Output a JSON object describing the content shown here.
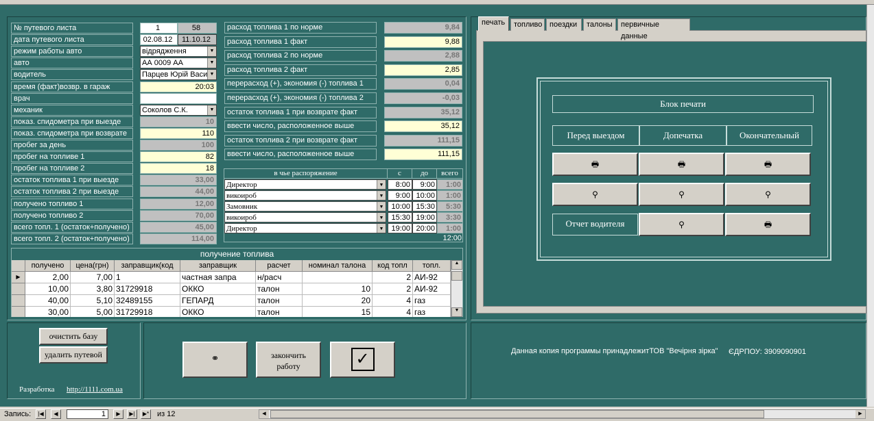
{
  "left_labels": [
    "№ путевого листа",
    "дата путевого листа",
    "режим работы авто",
    "авто",
    "водитель",
    "время (факт)возвр. в гараж",
    "врач",
    "механик",
    "показ. спидометра при выезде",
    "показ. спидометра при возврате",
    "пробег за день",
    "пробег на топливе 1",
    "пробег на топливе 2",
    "остаток  топлива 1 при выезде",
    "остаток топлива 2 при выезде",
    "получено топливо 1",
    "получено топливо 2",
    "всего топл. 1 (остаток+получено)",
    "всего топл. 2 (остаток+получено)"
  ],
  "left_values": {
    "waybill_no": "1",
    "waybill_no2": "58",
    "date": "02.08.12",
    "date2": "11.10.12",
    "mode": "відрядження",
    "auto": "АА 0009 АА",
    "driver": "Парцев Юрій Васи",
    "return_time": "20:03",
    "doctor": "",
    "mechanic": "Соколов С.К.",
    "odo_out": "10",
    "odo_in": "110",
    "mileage": "100",
    "mileage_f1": "82",
    "mileage_f2": "18",
    "rest1_out": "33,00",
    "rest2_out": "44,00",
    "recv1": "12,00",
    "recv2": "70,00",
    "total1": "45,00",
    "total2": "114,00"
  },
  "mid_labels": [
    "расход топлива 1 по норме",
    "расход топлива 1 факт",
    "расход топлива 2 по норме",
    "расход топлива 2 факт",
    "перерасход (+), экономия (-) топлива 1",
    "перерасход (+), экономия (-) топлива 2",
    "остаток топлива 1 при возврате факт",
    "ввести число, расположенное выше",
    "остаток топлива 2 при возврате факт",
    "ввести число, расположенное выше"
  ],
  "mid_values": [
    "9,84",
    "9,88",
    "2,88",
    "2,85",
    "0,04",
    "-0,03",
    "35,12",
    "35,12",
    "111,15",
    "111,15"
  ],
  "disposal": {
    "headers": [
      "в чье распоряжение",
      "с",
      "до",
      "всего"
    ],
    "rows": [
      [
        "Директор",
        "8:00",
        "9:00",
        "1:00"
      ],
      [
        "викоироб",
        "9:00",
        "10:00",
        "1:00"
      ],
      [
        "Замовник",
        "10:00",
        "15:30",
        "5:30"
      ],
      [
        "викоироб",
        "15:30",
        "19:00",
        "3:30"
      ],
      [
        "Директор",
        "19:00",
        "20:00",
        "1:00"
      ]
    ],
    "total": "12:00"
  },
  "fuel": {
    "title": "получение топлива",
    "headers": [
      "получено",
      "цена(грн)",
      "заправщик(код",
      "заправщик",
      "расчет",
      "номинал талона",
      "код топл",
      "топл."
    ],
    "rows": [
      [
        "2,00",
        "7,00",
        "1",
        "частная запра",
        "н/расч",
        "",
        "2",
        "АИ-92"
      ],
      [
        "10,00",
        "3,80",
        "31729918",
        "ОККО",
        "талон",
        "10",
        "2",
        "АИ-92"
      ],
      [
        "40,00",
        "5,10",
        "32489155",
        "ГЕПАРД",
        "талон",
        "20",
        "4",
        "газ"
      ],
      [
        "30,00",
        "5,00",
        "31729918",
        "ОККО",
        "талон",
        "15",
        "4",
        "газ"
      ]
    ]
  },
  "tabs": [
    "печать",
    "топливо",
    "поездки",
    "талоны",
    "первичные данные"
  ],
  "print_block": {
    "title": "Блок печати",
    "cols": [
      "Перед выездом",
      "Допечатка",
      "Окончательный"
    ],
    "driver_report": "Отчет водителя"
  },
  "buttons": {
    "clear_db": "очистить базу",
    "delete_waybill": "удалить путевой",
    "finish": "закончить работу"
  },
  "dev": {
    "label": "Разработка",
    "link": "http://1111.com.ua"
  },
  "license": {
    "text": "Данная копия программы принадлежитТОВ \"Вечірня зірка\"",
    "code": "ЄДРПОУ: 3909090901"
  },
  "record_nav": {
    "label": "Запись:",
    "current": "1",
    "of": "из  12"
  }
}
